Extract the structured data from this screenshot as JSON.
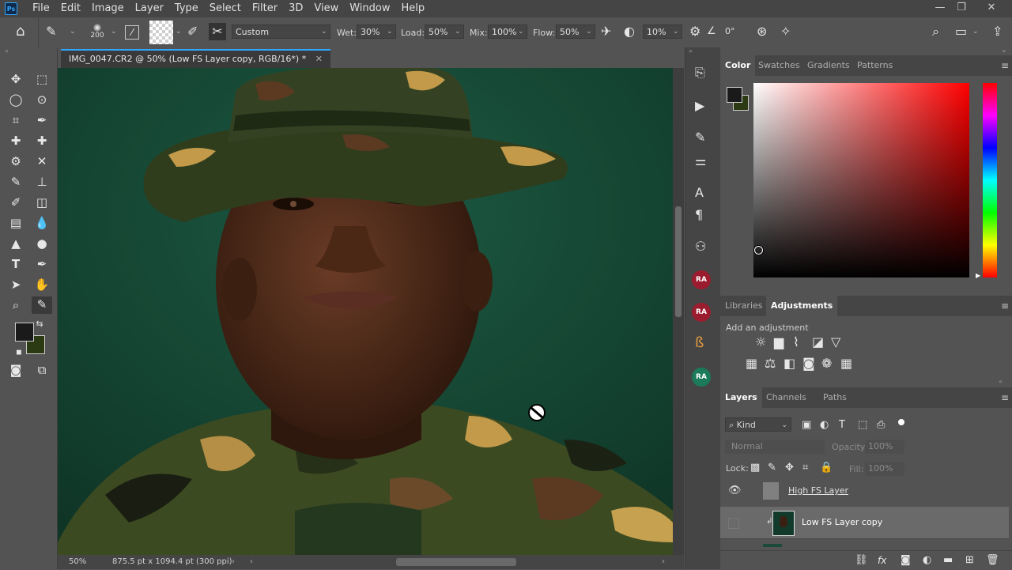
{
  "app": {
    "logo": "Ps"
  },
  "menu": [
    "File",
    "Edit",
    "Image",
    "Layer",
    "Type",
    "Select",
    "Filter",
    "3D",
    "View",
    "Window",
    "Help"
  ],
  "window_controls": {
    "minimize": "—",
    "restore": "❐",
    "close": "✕"
  },
  "options": {
    "brush_size": "200",
    "preset": "Custom",
    "wet_label": "Wet:",
    "wet_value": "30%",
    "load_label": "Load:",
    "load_value": "50%",
    "mix_label": "Mix:",
    "mix_value": "100%",
    "flow_label": "Flow:",
    "flow_value": "50%",
    "smoothing_value": "10%",
    "angle_value": "0°"
  },
  "document": {
    "tab_title": "IMG_0047.CR2 @ 50% (Low FS Layer copy, RGB/16*) *",
    "zoom": "50%",
    "dimensions": "875.5 pt x 1094.4 pt (300 ppi)"
  },
  "mid_strip": {
    "ra_label": "RA"
  },
  "color_panel": {
    "tabs": [
      "Color",
      "Swatches",
      "Gradients",
      "Patterns"
    ],
    "fg_color": "#1a1a1a",
    "bg_color": "#2c3a14",
    "hue_color": "#ff0000"
  },
  "adjustments_panel": {
    "tabs": [
      "Libraries",
      "Adjustments"
    ],
    "hint": "Add an adjustment"
  },
  "layers_panel": {
    "tabs": [
      "Layers",
      "Channels",
      "Paths"
    ],
    "filter_kind": "Kind",
    "blend_mode": "Normal",
    "opacity_label": "Opacity:",
    "opacity_value": "100%",
    "lock_label": "Lock:",
    "fill_label": "Fill:",
    "fill_value": "100%",
    "layers": [
      {
        "name": "High FS Layer",
        "visible": true
      },
      {
        "name": "Low FS Layer copy",
        "visible": false
      }
    ]
  }
}
